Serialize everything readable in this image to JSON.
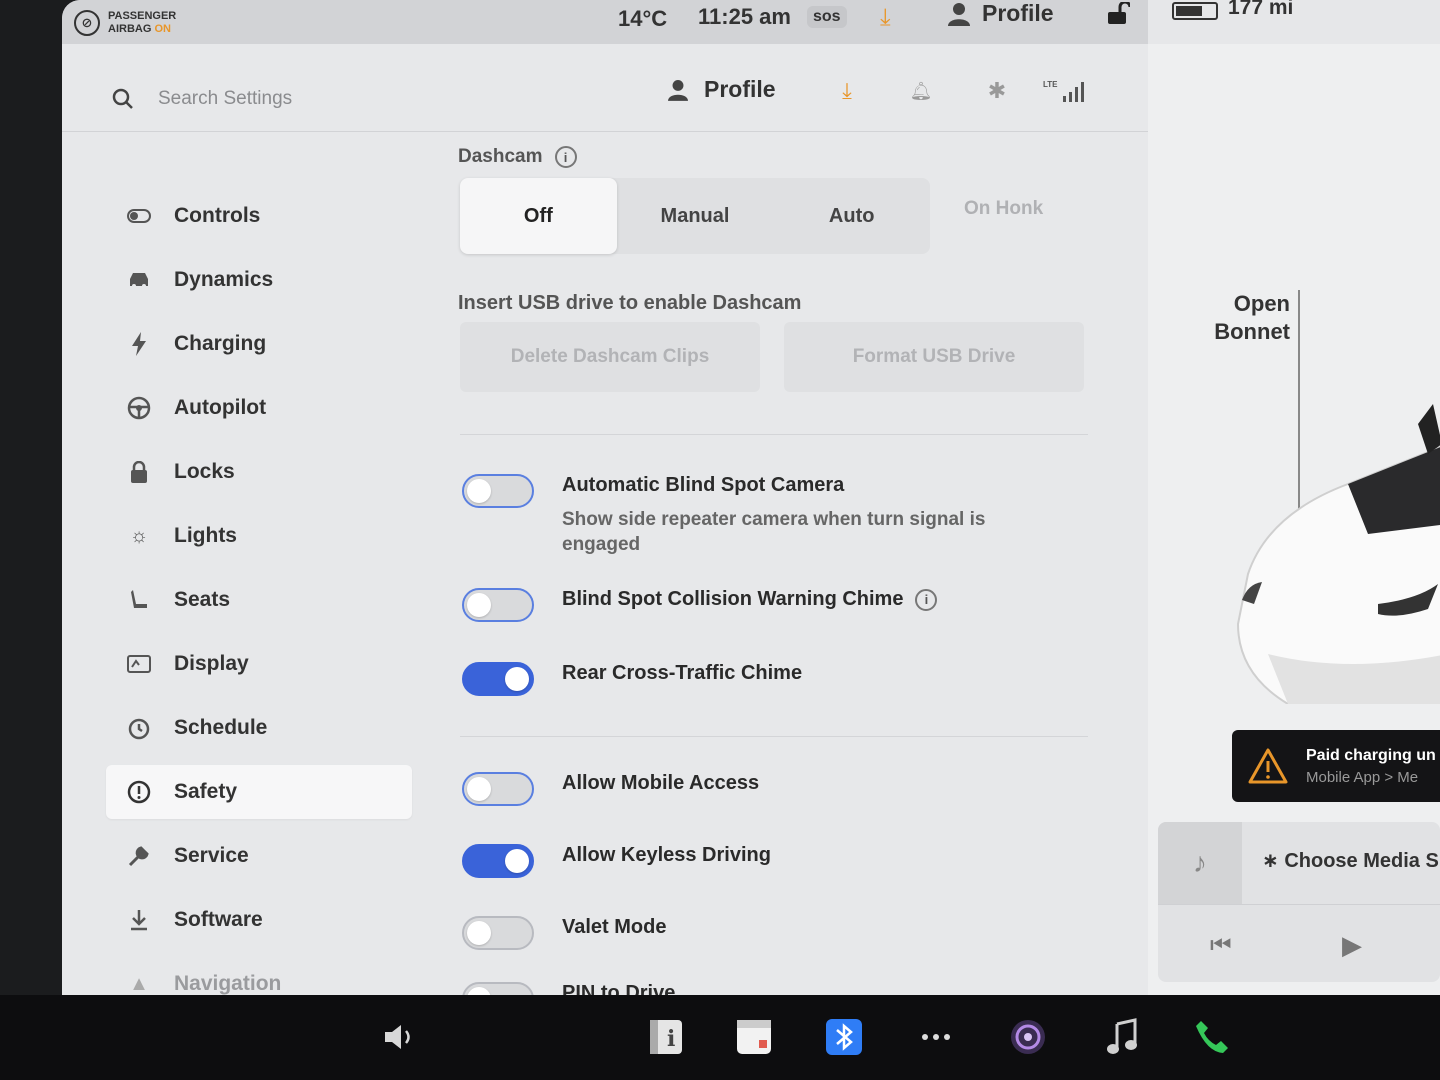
{
  "status_bar": {
    "airbag_line1": "PASSENGER",
    "airbag_line2": "AIRBAG",
    "airbag_state": "ON",
    "temperature": "14°C",
    "time": "11:25 am",
    "sos": "sos",
    "profile_label": "Profile",
    "range": "177 mi",
    "accent_color": "#e8962a"
  },
  "header": {
    "search_placeholder": "Search Settings",
    "profile_label": "Profile",
    "icons": [
      "download-icon",
      "bell-icon",
      "bluetooth-icon",
      "lte-signal-icon"
    ],
    "lte_label": "LTE"
  },
  "sidebar": {
    "items": [
      {
        "label": "Controls",
        "icon": "toggle-icon"
      },
      {
        "label": "Dynamics",
        "icon": "car-icon"
      },
      {
        "label": "Charging",
        "icon": "bolt-icon"
      },
      {
        "label": "Autopilot",
        "icon": "steering-wheel-icon"
      },
      {
        "label": "Locks",
        "icon": "lock-icon"
      },
      {
        "label": "Lights",
        "icon": "sun-icon"
      },
      {
        "label": "Seats",
        "icon": "seat-icon"
      },
      {
        "label": "Display",
        "icon": "display-icon"
      },
      {
        "label": "Schedule",
        "icon": "clock-icon"
      },
      {
        "label": "Safety",
        "icon": "alert-circle-icon",
        "active": true
      },
      {
        "label": "Service",
        "icon": "wrench-icon"
      },
      {
        "label": "Software",
        "icon": "download-icon"
      },
      {
        "label": "Navigation",
        "icon": "navigation-icon"
      }
    ]
  },
  "dashcam": {
    "label": "Dashcam",
    "options": [
      "Off",
      "Manual",
      "Auto"
    ],
    "selected": "Off",
    "extra_option": "On Honk",
    "note": "Insert USB drive to enable Dashcam",
    "delete_button": "Delete Dashcam Clips",
    "format_button": "Format USB Drive"
  },
  "toggles": [
    {
      "title": "Automatic Blind Spot Camera",
      "subtitle": "Show side repeater camera when turn signal is engaged",
      "on": false
    },
    {
      "title": "Blind Spot Collision Warning Chime",
      "subtitle": "",
      "on": false,
      "info": true
    },
    {
      "title": "Rear Cross-Traffic Chime",
      "subtitle": "",
      "on": true
    },
    {
      "title": "Allow Mobile Access",
      "subtitle": "",
      "on": false
    },
    {
      "title": "Allow Keyless Driving",
      "subtitle": "",
      "on": true
    },
    {
      "title": "Valet Mode",
      "subtitle": "",
      "on": false
    },
    {
      "title": "PIN to Drive",
      "subtitle": "",
      "on": false
    }
  ],
  "right_panel": {
    "open_label_1": "Open",
    "open_label_2": "Bonnet",
    "alert_title": "Paid charging un",
    "alert_sub": "Mobile App > Me",
    "media_label": "Choose Media S"
  },
  "dock": {
    "icons": [
      "volume-icon",
      "info-icon",
      "calendar-icon",
      "bluetooth-icon",
      "more-icon",
      "camera-icon",
      "music-icon",
      "phone-icon"
    ]
  }
}
